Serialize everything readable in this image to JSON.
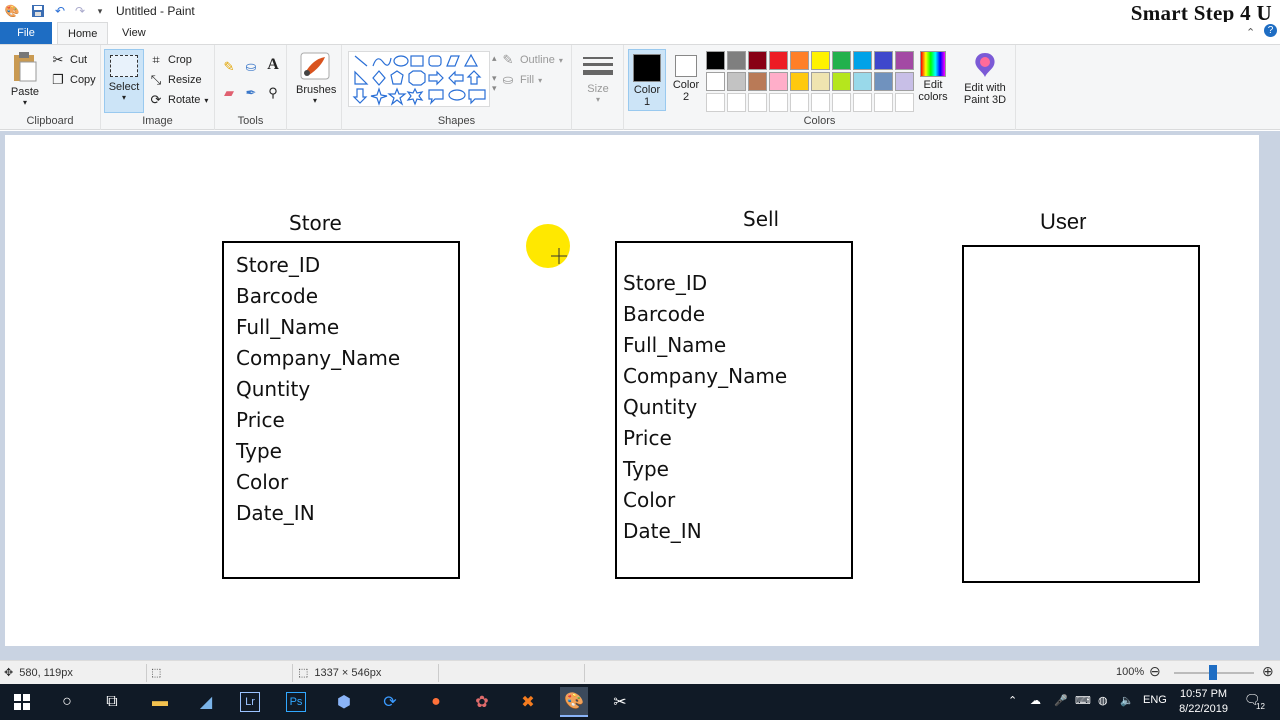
{
  "window": {
    "title": "Untitled - Paint",
    "watermark": "Smart Step 4 U"
  },
  "ribbon_tabs": [
    "File",
    "Home",
    "View"
  ],
  "ribbon": {
    "clipboard": {
      "paste": "Paste",
      "cut": "Cut",
      "copy": "Copy",
      "label": "Clipboard"
    },
    "image": {
      "select": "Select",
      "crop": "Crop",
      "resize": "Resize",
      "rotate": "Rotate",
      "label": "Image"
    },
    "tools": {
      "label": "Tools"
    },
    "brushes": {
      "label": "Brushes"
    },
    "shapes": {
      "outline": "Outline",
      "fill": "Fill",
      "label": "Shapes"
    },
    "size": {
      "label": "Size"
    },
    "colors": {
      "color1": "Color\n1",
      "color1_a": "Color",
      "color1_b": "1",
      "color2_a": "Color",
      "color2_b": "2",
      "edit_colors_a": "Edit",
      "edit_colors_b": "colors",
      "label": "Colors",
      "color1_value": "#000000",
      "color2_value": "#ffffff",
      "palette": [
        "#000000",
        "#7f7f7f",
        "#880015",
        "#ed1c24",
        "#ff7f27",
        "#fff200",
        "#22b14c",
        "#00a2e8",
        "#3f48cc",
        "#a349a4",
        "#ffffff",
        "#c3c3c3",
        "#b97a57",
        "#ffaec9",
        "#ffc90e",
        "#efe4b0",
        "#b5e61d",
        "#99d9ea",
        "#7092be",
        "#c8bfe7",
        "#ffffff",
        "#ffffff",
        "#ffffff",
        "#ffffff",
        "#ffffff",
        "#ffffff",
        "#ffffff",
        "#ffffff",
        "#ffffff",
        "#ffffff"
      ]
    },
    "paint3d": {
      "line1": "Edit with",
      "line2": "Paint 3D"
    }
  },
  "canvas": {
    "entities": [
      {
        "title": "Store",
        "fields": [
          "Store_ID",
          "Barcode",
          "Full_Name",
          "Company_Name",
          "Quntity",
          "Price",
          "Type",
          "Color",
          "Date_IN"
        ]
      },
      {
        "title": "Sell",
        "fields": [
          "Store_ID",
          "Barcode",
          "Full_Name",
          "Company_Name",
          "Quntity",
          "Price",
          "Type",
          "Color",
          "Date_IN"
        ]
      },
      {
        "title": "User",
        "fields": []
      }
    ]
  },
  "statusbar": {
    "cursor_pos": "580, 119px",
    "canvas_size": "1337 × 546px",
    "zoom": "100%"
  },
  "taskbar": {
    "time": "10:57 PM",
    "date": "8/22/2019",
    "lang": "ENG",
    "notif_count": "12"
  }
}
